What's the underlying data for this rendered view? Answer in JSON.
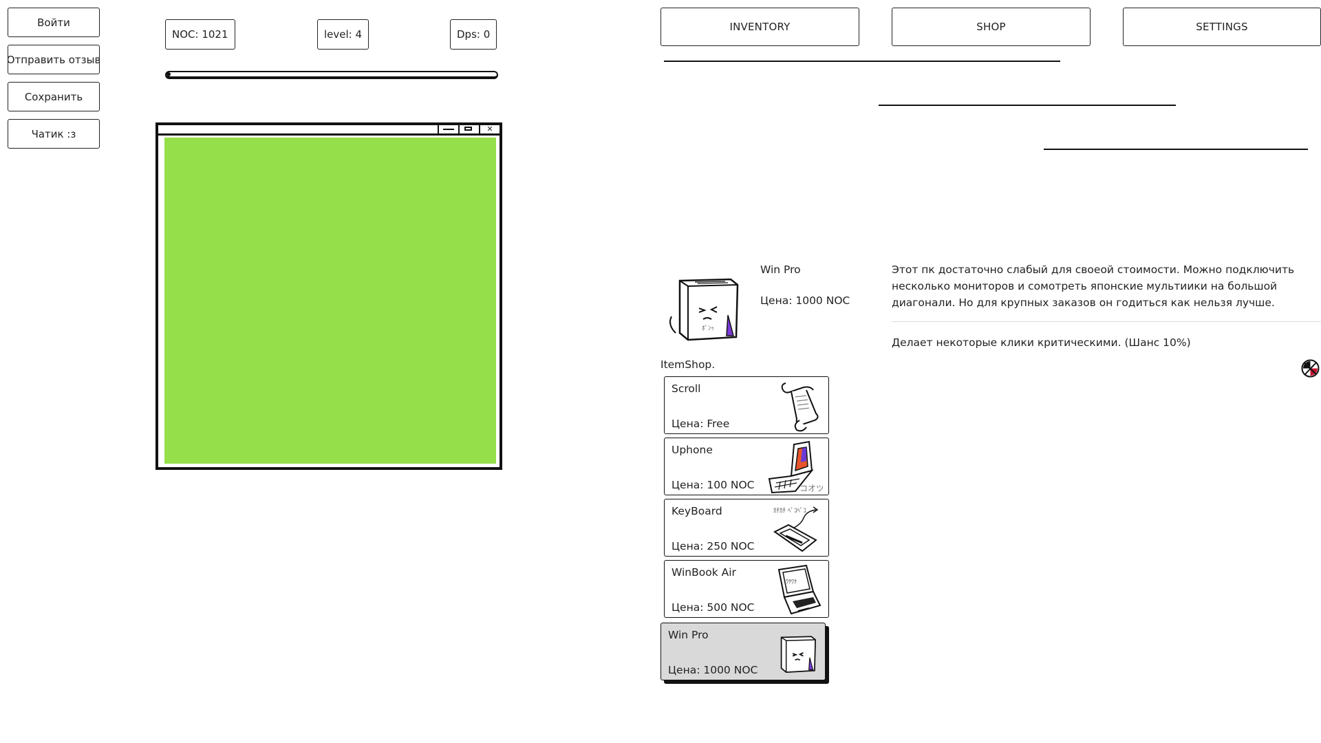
{
  "sidebar": {
    "login": "Войти",
    "feedback": "Отправить отзыв",
    "save": "Сохранить",
    "chat": "Чатик :з"
  },
  "stats": {
    "noc": "NOC: 1021",
    "level": "level: 4",
    "dps": "Dps: 0",
    "progress": 0.0
  },
  "game_window": {
    "screen_color": "#95e04a",
    "controls": [
      "minimize-icon",
      "maximize-icon",
      "close-icon"
    ]
  },
  "tabs": {
    "inventory": "INVENTORY",
    "shop": "SHOP",
    "settings": "SETTINGS"
  },
  "detail": {
    "name": "Win Pro",
    "price": "Цена: 1000 NOC",
    "description": "Этот пк достаточно слабый для своеой стоимости. Можно подключить несколько мониторов и сомотреть японские мультиики на большой диагонали. Но для крупных заказов он годиться как нельзя лучше.",
    "effect": "Делает некоторые клики критическими. (Шанс 10%)"
  },
  "shop": {
    "title": "ItemShop.",
    "items": [
      {
        "name": "Scroll",
        "price": "Цена: Free",
        "icon": "scroll-icon"
      },
      {
        "name": "Uphone",
        "price": "Цена: 100 NOC",
        "icon": "phone-icon"
      },
      {
        "name": "KeyBoard",
        "price": "Цена: 250 NOC",
        "icon": "keyboard-icon"
      },
      {
        "name": "WinBook Air",
        "price": "Цена: 500 NOC",
        "icon": "laptop-icon"
      },
      {
        "name": "Win Pro",
        "price": "Цена: 1000 NOC",
        "icon": "pc-case-icon",
        "selected": true
      }
    ]
  }
}
